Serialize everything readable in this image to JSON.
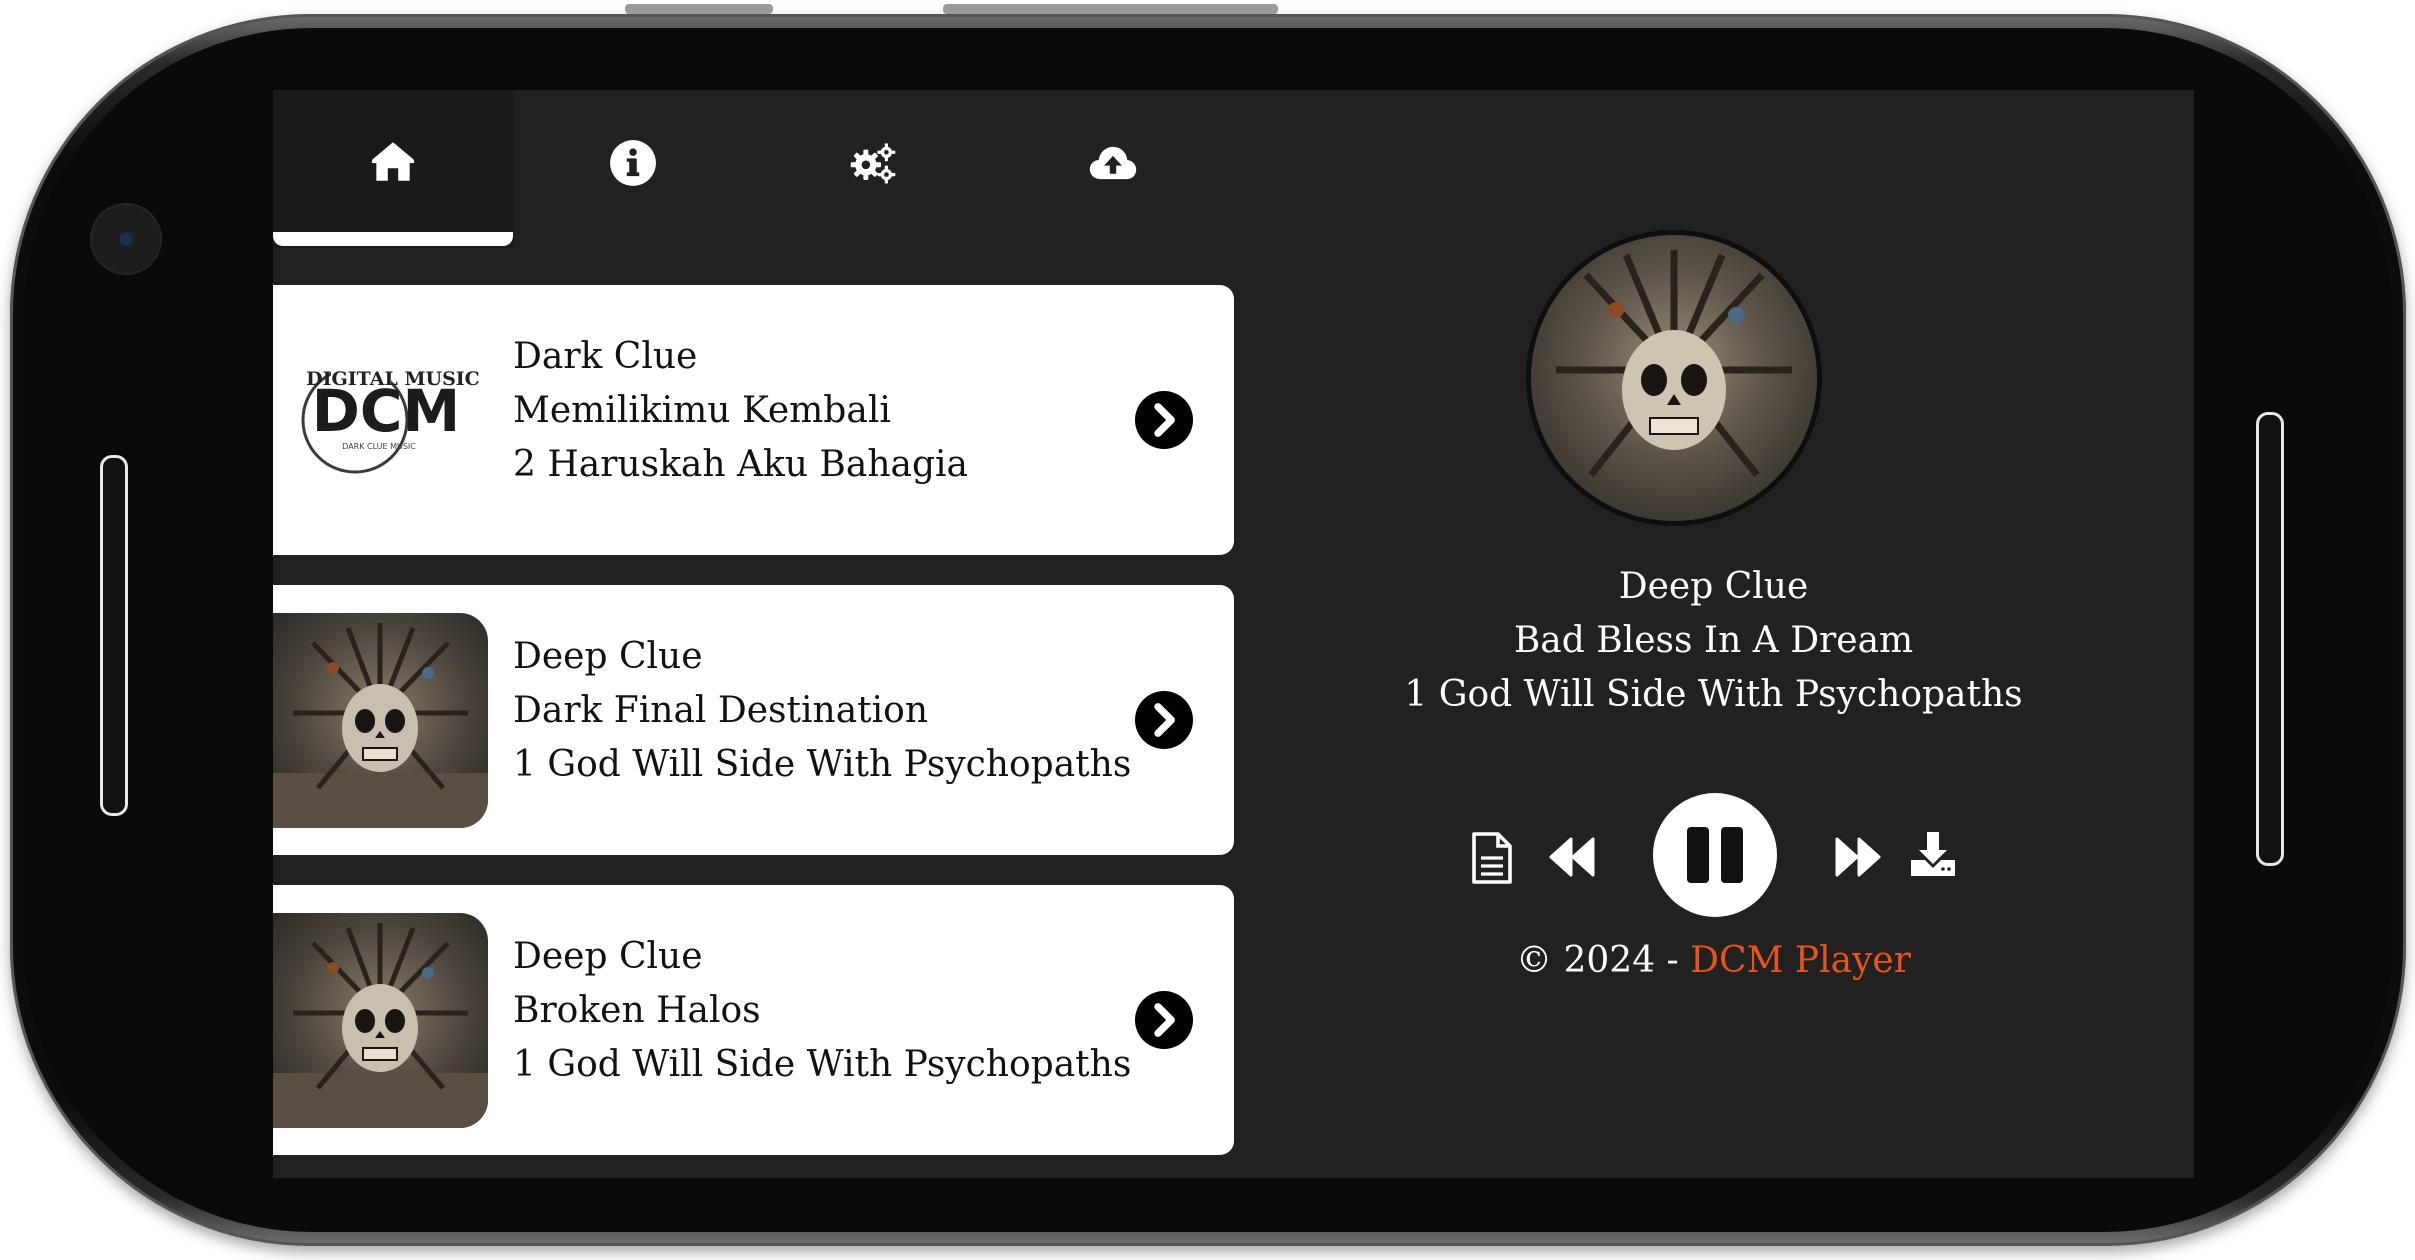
{
  "tabs": [
    {
      "name": "home",
      "icon": "home-icon",
      "active": true
    },
    {
      "name": "info",
      "icon": "info-icon",
      "active": false
    },
    {
      "name": "settings",
      "icon": "gears-icon",
      "active": false
    },
    {
      "name": "upload",
      "icon": "cloud-upload-icon",
      "active": false
    }
  ],
  "playlist": [
    {
      "artist": "Dark Clue",
      "title": "Memilikimu Kembali",
      "album": "2 Haruskah Aku Bahagia",
      "cover": "dcm-logo",
      "logo": {
        "top": "DIGITAL MUSIC",
        "main": "DCM",
        "sub": "DARK CLUE MUSIC"
      }
    },
    {
      "artist": "Deep Clue",
      "title": "Dark Final Destination",
      "album": "1 God Will Side With Psychopaths",
      "cover": "skull-art"
    },
    {
      "artist": "Deep Clue",
      "title": "Broken Halos",
      "album": "1 God Will Side With Psychopaths",
      "cover": "skull-art"
    }
  ],
  "now_playing": {
    "artist": "Deep Clue",
    "title": "Bad Bless In A Dream",
    "album": "1 God Will Side With Psychopaths",
    "state": "playing"
  },
  "footer": {
    "prefix": "© 2024 - ",
    "brand": "DCM Player"
  },
  "colors": {
    "screen_bg": "#212121",
    "card_bg": "#ffffff",
    "accent": "#e8541b"
  }
}
